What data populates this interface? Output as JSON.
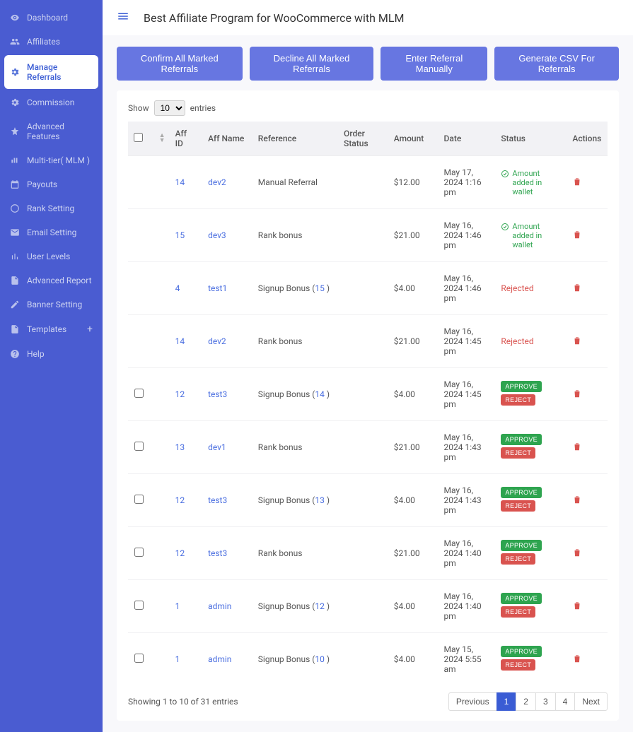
{
  "header": {
    "title": "Best Affiliate Program for WooCommerce with MLM"
  },
  "sidebar": {
    "items": [
      {
        "label": "Dashboard",
        "icon": "eye"
      },
      {
        "label": "Affiliates",
        "icon": "users"
      },
      {
        "label": "Manage Referrals",
        "icon": "gear",
        "active": true
      },
      {
        "label": "Commission",
        "icon": "gear"
      },
      {
        "label": "Advanced Features",
        "icon": "star"
      },
      {
        "label": "Multi-tier( MLM )",
        "icon": "bars"
      },
      {
        "label": "Payouts",
        "icon": "calendar"
      },
      {
        "label": "Rank Setting",
        "icon": "circle"
      },
      {
        "label": "Email Setting",
        "icon": "mail"
      },
      {
        "label": "User Levels",
        "icon": "stats"
      },
      {
        "label": "Advanced Report",
        "icon": "doc"
      },
      {
        "label": "Banner Setting",
        "icon": "pencil"
      },
      {
        "label": "Templates",
        "icon": "doc",
        "plus": "+"
      },
      {
        "label": "Help",
        "icon": "help"
      }
    ]
  },
  "actions": {
    "confirm": "Confirm All Marked Referrals",
    "decline": "Decline All Marked Referrals",
    "manual": "Enter Referral Manually",
    "csv": "Generate CSV For Referrals"
  },
  "table": {
    "show_label": "Show",
    "entries_label": "entries",
    "entries_value": "10",
    "columns": {
      "affid": "Aff ID",
      "affname": "Aff Name",
      "reference": "Reference",
      "orderstatus": "Order Status",
      "amount": "Amount",
      "date": "Date",
      "status": "Status",
      "actions": "Actions"
    },
    "rows": [
      {
        "noCheck": true,
        "affid": "14",
        "affname": "dev2",
        "reference": "Manual Referral",
        "amount": "$12.00",
        "date": "May 17, 2024 1:16 pm",
        "status_type": "wallet",
        "status_text": "Amount added in wallet"
      },
      {
        "noCheck": true,
        "affid": "15",
        "affname": "dev3",
        "reference": "Rank bonus",
        "amount": "$21.00",
        "date": "May 16, 2024 1:46 pm",
        "status_type": "wallet",
        "status_text": "Amount added in wallet"
      },
      {
        "noCheck": true,
        "affid": "4",
        "affname": "test1",
        "reference": "Signup Bonus (",
        "ref_link": "15",
        "ref_suffix": " )",
        "amount": "$4.00",
        "date": "May 16, 2024 1:46 pm",
        "status_type": "rejected",
        "status_text": "Rejected"
      },
      {
        "noCheck": true,
        "affid": "14",
        "affname": "dev2",
        "reference": "Rank bonus",
        "amount": "$21.00",
        "date": "May 16, 2024 1:45 pm",
        "status_type": "rejected",
        "status_text": "Rejected"
      },
      {
        "affid": "12",
        "affname": "test3",
        "reference": "Signup Bonus (",
        "ref_link": "14",
        "ref_suffix": " )",
        "amount": "$4.00",
        "date": "May 16, 2024 1:45 pm",
        "status_type": "pending"
      },
      {
        "affid": "13",
        "affname": "dev1",
        "reference": "Rank bonus",
        "amount": "$21.00",
        "date": "May 16, 2024 1:43 pm",
        "status_type": "pending"
      },
      {
        "affid": "12",
        "affname": "test3",
        "reference": "Signup Bonus (",
        "ref_link": "13",
        "ref_suffix": " )",
        "amount": "$4.00",
        "date": "May 16, 2024 1:43 pm",
        "status_type": "pending"
      },
      {
        "affid": "12",
        "affname": "test3",
        "reference": "Rank bonus",
        "amount": "$21.00",
        "date": "May 16, 2024 1:40 pm",
        "status_type": "pending"
      },
      {
        "affid": "1",
        "affname": "admin",
        "reference": "Signup Bonus (",
        "ref_link": "12",
        "ref_suffix": " )",
        "amount": "$4.00",
        "date": "May 16, 2024 1:40 pm",
        "status_type": "pending"
      },
      {
        "affid": "1",
        "affname": "admin",
        "reference": "Signup Bonus (",
        "ref_link": "10",
        "ref_suffix": " )",
        "amount": "$4.00",
        "date": "May 15, 2024 5:55 am",
        "status_type": "pending"
      }
    ],
    "approve_label": "APPROVE",
    "reject_label": "REJECT",
    "info": "Showing 1 to 10 of 31 entries",
    "pagination": {
      "prev": "Previous",
      "next": "Next",
      "pages": [
        "1",
        "2",
        "3",
        "4"
      ],
      "active": 1
    }
  }
}
